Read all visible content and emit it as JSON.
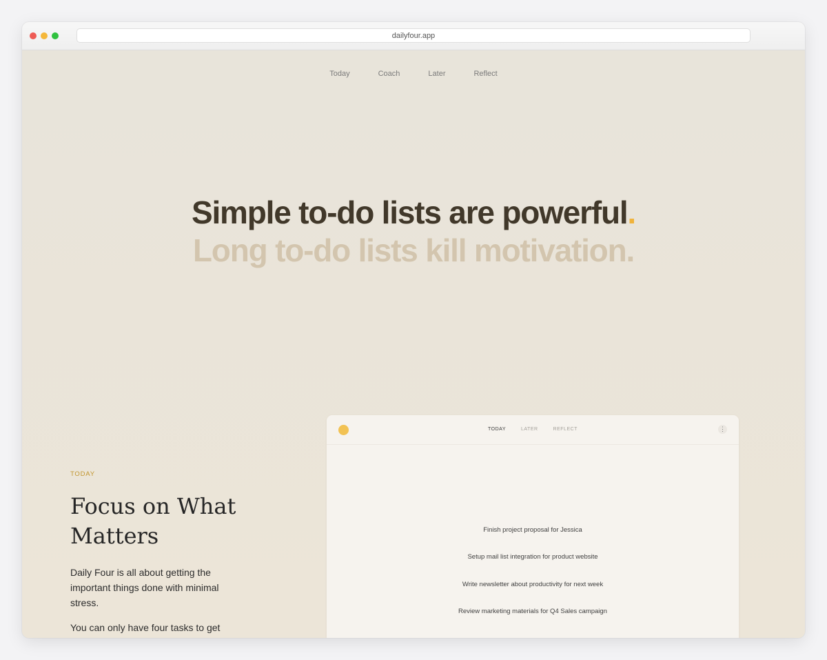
{
  "browser": {
    "url": "dailyfour.app"
  },
  "nav": {
    "items": [
      "Today",
      "Coach",
      "Later",
      "Reflect"
    ]
  },
  "hero": {
    "line1": "Simple to-do lists are powerful",
    "line1_period": ".",
    "line2": "Long to-do lists kill motivation."
  },
  "section": {
    "eyebrow": "TODAY",
    "title": "Focus on What Matters",
    "paragraph1": "Daily Four is all about getting the important things done with minimal stress.",
    "paragraph2": "You can only have four tasks to get"
  },
  "app_mock": {
    "tabs": [
      "TODAY",
      "LATER",
      "REFLECT"
    ],
    "active_tab": "TODAY",
    "more_icon": "⋮",
    "tasks": [
      "Finish project proposal for Jessica",
      "Setup mail list integration for product website",
      "Write newsletter about productivity for next week",
      "Review marketing materials for Q4 Sales campaign"
    ]
  },
  "colors": {
    "accent": "#f0b33b",
    "hero_dark": "#41382a",
    "hero_light": "#d3c5ae",
    "eyebrow": "#c2962e",
    "background": "#e9e4d8"
  }
}
